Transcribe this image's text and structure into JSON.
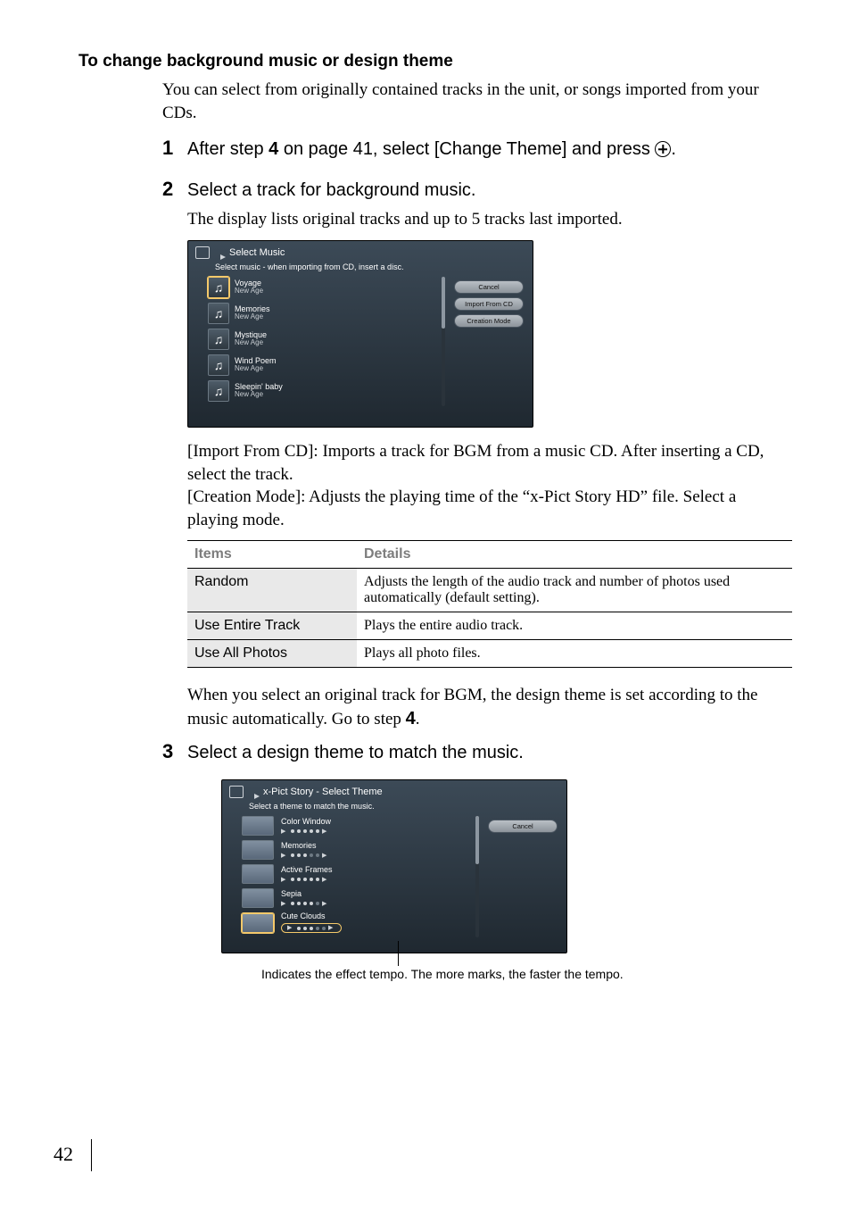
{
  "heading": "To change background music or design theme",
  "intro": "You can select from originally contained tracks in the unit, or songs imported from your CDs.",
  "step1": {
    "num": "1",
    "pre": "After step ",
    "refnum": "4",
    "mid": " on page 41, select [Change Theme] and press ",
    "post": "."
  },
  "step2": {
    "num": "2",
    "text": "Select a track for background music.",
    "sub": "The display lists original tracks and up to 5 tracks last imported."
  },
  "osd_music": {
    "title": "Select Music",
    "subtitle": "Select music - when importing from CD, insert a disc.",
    "tracks": [
      {
        "title": "Voyage",
        "artist": "New Age"
      },
      {
        "title": "Memories",
        "artist": "New Age"
      },
      {
        "title": "Mystique",
        "artist": "New Age"
      },
      {
        "title": "Wind Poem",
        "artist": "New Age"
      },
      {
        "title": "Sleepin' baby",
        "artist": "New Age"
      }
    ],
    "buttons": {
      "cancel": "Cancel",
      "import": "Import From CD",
      "creation": "Creation Mode"
    }
  },
  "after_music_para": "[Import From CD]: Imports a track for BGM from a music CD. After inserting a CD, select the track.\n[Creation Mode]: Adjusts the playing time of the “x-Pict Story HD” file. Select a playing mode.",
  "table": {
    "head": {
      "items": "Items",
      "details": "Details"
    },
    "rows": [
      {
        "item": "Random",
        "detail": "Adjusts the length of the audio track and number of photos used automatically (default setting)."
      },
      {
        "item": "Use Entire Track",
        "detail": "Plays the entire audio track."
      },
      {
        "item": "Use All Photos",
        "detail": "Plays all photo files."
      }
    ]
  },
  "after_table": {
    "pre": "When you select an original track for BGM, the design theme is set according to the music automatically. Go to step ",
    "refnum": "4",
    "post": "."
  },
  "step3": {
    "num": "3",
    "text": "Select a design theme to match the music."
  },
  "osd_theme": {
    "title": "x-Pict Story - Select Theme",
    "subtitle": "Select a theme to match the music.",
    "themes": [
      {
        "title": "Color Window"
      },
      {
        "title": "Memories"
      },
      {
        "title": "Active Frames"
      },
      {
        "title": "Sepia"
      },
      {
        "title": "Cute Clouds"
      }
    ],
    "cancel": "Cancel"
  },
  "caption": "Indicates the effect tempo. The more marks, the faster the tempo.",
  "page_number": "42"
}
